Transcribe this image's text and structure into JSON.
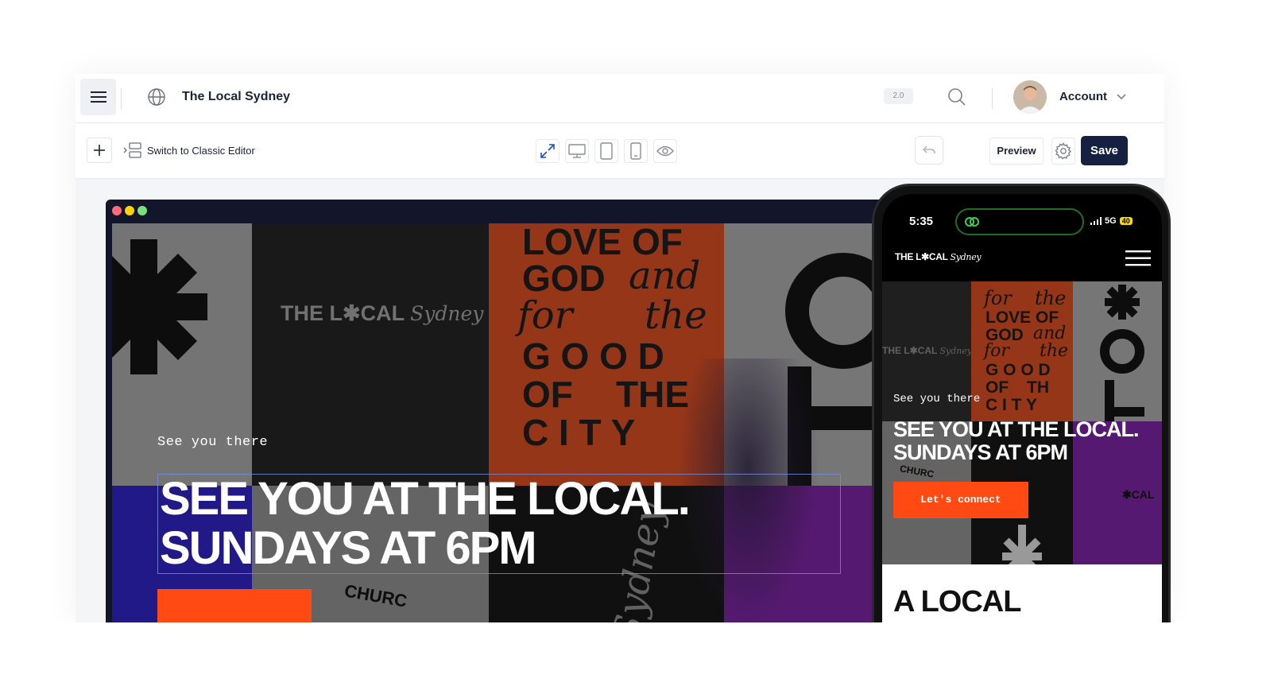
{
  "topbar": {
    "site_title": "The Local Sydney",
    "version": "2.0",
    "account_label": "Account"
  },
  "toolbar": {
    "classic_editor_label": "Switch to Classic Editor",
    "preview_label": "Preview",
    "save_label": "Save"
  },
  "hero": {
    "poster_logo": "THE L✱CAL",
    "poster_logo_script": "Sydney",
    "poster_lines": [
      "LOVE OF",
      "GOD",
      "and",
      "for",
      "the",
      "G O O D",
      "OF",
      "THE",
      "C I T Y"
    ],
    "subtitle": "See you there",
    "headline_line1": "SEE YOU AT THE LOCAL.",
    "headline_line2": "SUNDAYS AT 6PM",
    "church_text": "CHURC",
    "sydney_script": "Sydney"
  },
  "phone": {
    "time": "5:35",
    "network": "5G",
    "battery": "40",
    "logo": "THE L✱CAL",
    "logo_script": "Sydney",
    "poster_logo": "THE L✱CAL",
    "poster_logo_script": "Sydney",
    "poster_lines": [
      "for",
      "the",
      "LOVE OF",
      "GOD",
      "and",
      "for",
      "the",
      "G O O D",
      "OF",
      "TH",
      "C I T Y"
    ],
    "subtitle": "See you there",
    "headline": "SEE YOU AT THE LOCAL. SUNDAYS AT 6PM",
    "cta_label": "Let's connect",
    "church_text": "CHURC",
    "cal_text": "✱CAL",
    "section_heading": "A LOCAL"
  },
  "colors": {
    "save_bg": "#162142",
    "accent_orange": "#ff4a14",
    "purple": "#6a1f8a",
    "blue": "#2a1fa6",
    "phone_island_ring": "#1e6e2a"
  }
}
